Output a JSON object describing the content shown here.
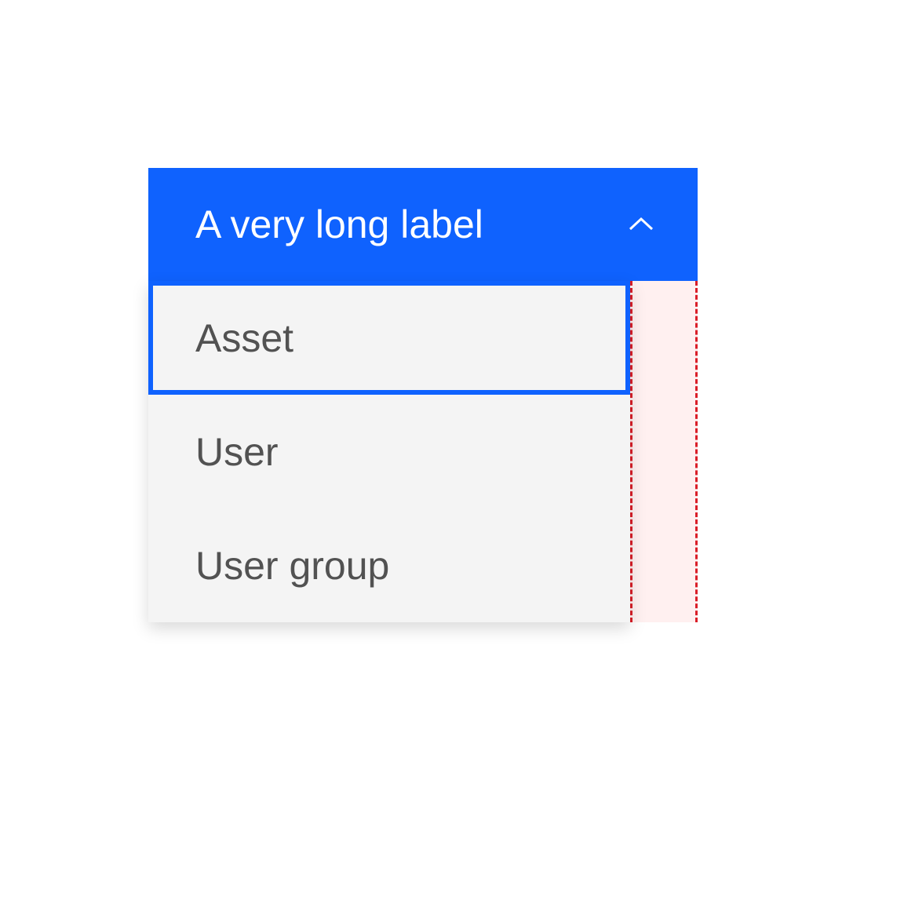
{
  "dropdown": {
    "selected_label": "A very long label",
    "options": [
      {
        "label": "Asset",
        "focused": true
      },
      {
        "label": "User",
        "focused": false
      },
      {
        "label": "User group",
        "focused": false
      }
    ]
  },
  "colors": {
    "primary": "#0f62fe",
    "menu_bg": "#f4f4f4",
    "text": "#525252",
    "error": "#da1e28",
    "error_bg": "#fff0f0"
  }
}
